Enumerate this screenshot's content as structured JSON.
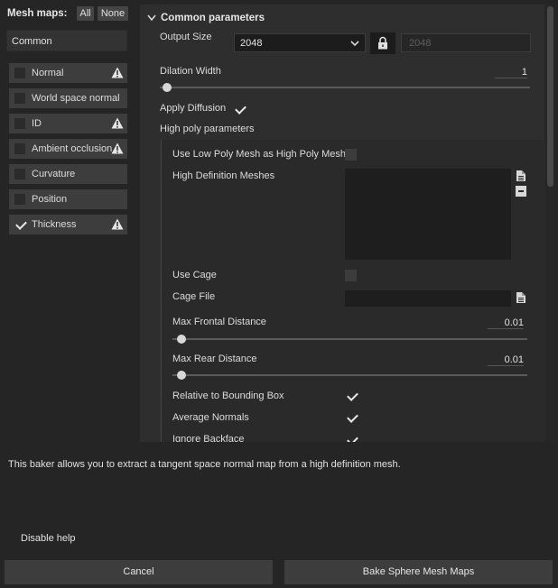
{
  "mesh_maps": {
    "title": "Mesh maps:",
    "all_label": "All",
    "none_label": "None",
    "common_label": "Common",
    "items": [
      {
        "label": "Normal",
        "checked": false,
        "warning": true
      },
      {
        "label": "World space normal",
        "checked": false,
        "warning": false
      },
      {
        "label": "ID",
        "checked": false,
        "warning": true
      },
      {
        "label": "Ambient occlusion",
        "checked": false,
        "warning": true
      },
      {
        "label": "Curvature",
        "checked": false,
        "warning": false
      },
      {
        "label": "Position",
        "checked": false,
        "warning": false
      },
      {
        "label": "Thickness",
        "checked": true,
        "warning": true
      }
    ]
  },
  "common_params": {
    "section_title": "Common parameters",
    "output_size_label": "Output Size",
    "output_size_value": "2048",
    "output_size_locked_value": "2048",
    "dilation_width_label": "Dilation Width",
    "dilation_width_value": "1",
    "apply_diffusion_label": "Apply Diffusion",
    "apply_diffusion_checked": true,
    "high_poly_label": "High poly parameters",
    "use_low_poly_label": "Use Low Poly Mesh as High Poly Mesh",
    "use_low_poly_checked": false,
    "high_def_meshes_label": "High Definition Meshes",
    "use_cage_label": "Use Cage",
    "use_cage_checked": false,
    "cage_file_label": "Cage File",
    "max_frontal_label": "Max Frontal Distance",
    "max_frontal_value": "0.01",
    "max_rear_label": "Max Rear Distance",
    "max_rear_value": "0.01",
    "relative_bbox_label": "Relative to Bounding Box",
    "relative_bbox_checked": true,
    "average_normals_label": "Average Normals",
    "average_normals_checked": true,
    "ignore_backface_label": "Ignore Backface",
    "ignore_backface_checked": true
  },
  "help": {
    "text": "This baker allows you to extract a tangent space normal map from a high definition mesh.",
    "disable_label": "Disable help"
  },
  "footer": {
    "cancel_label": "Cancel",
    "bake_label": "Bake Sphere Mesh Maps"
  },
  "colors": {
    "background": "#252525",
    "panel": "#2e2e2e",
    "button": "#3d3d3d",
    "text": "#dcdcdc"
  }
}
